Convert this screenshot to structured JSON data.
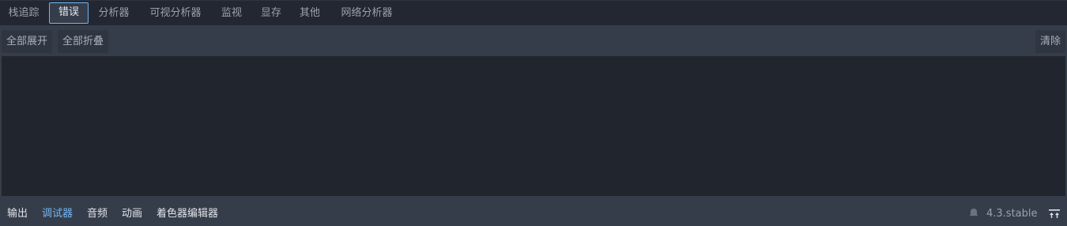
{
  "top_tabs": [
    {
      "label": "栈追踪"
    },
    {
      "label": "错误"
    },
    {
      "label": "分析器"
    },
    {
      "label": "可视分析器"
    },
    {
      "label": "监视"
    },
    {
      "label": "显存"
    },
    {
      "label": "其他"
    },
    {
      "label": "网络分析器"
    }
  ],
  "active_top_tab": "错误",
  "toolbar": {
    "expand_all": "全部展开",
    "collapse_all": "全部折叠",
    "clear": "清除"
  },
  "bottom_tabs": [
    {
      "label": "输出"
    },
    {
      "label": "调试器"
    },
    {
      "label": "音频"
    },
    {
      "label": "动画"
    },
    {
      "label": "着色器编辑器"
    }
  ],
  "active_bottom_tab": "调试器",
  "version": "4.3.stable",
  "colors": {
    "accent": "#70b6f5",
    "panel_bg": "#21262e",
    "editor_bg": "#363d4a"
  },
  "icons": {
    "version_icon": "godot-notification-icon",
    "pin_icon": "pin-bottom-panel-icon"
  }
}
